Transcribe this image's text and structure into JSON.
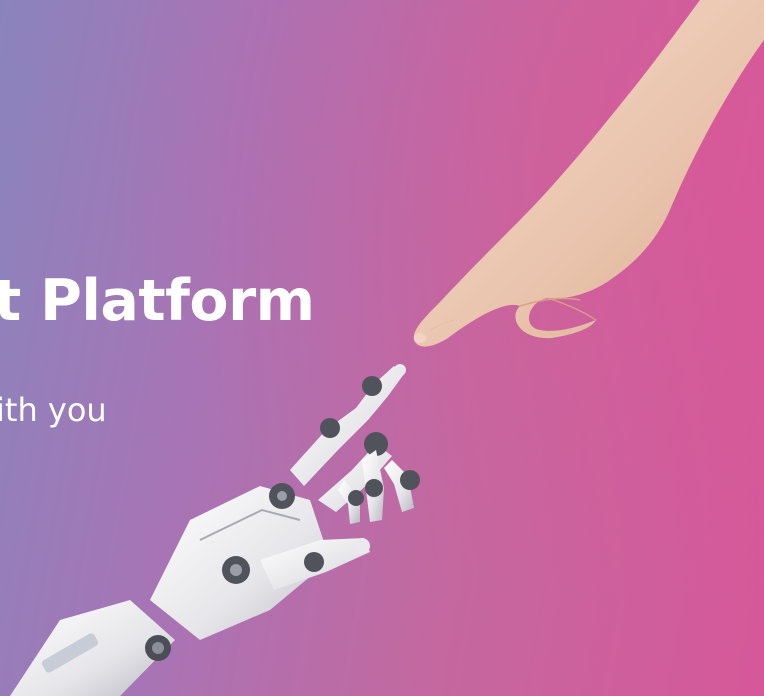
{
  "hero": {
    "headline": "t Platform",
    "subline": "ith you"
  },
  "colors": {
    "gradient_left": "#8a84bd",
    "gradient_mid": "#c4689f",
    "gradient_right": "#d6589a",
    "text": "#ffffff"
  },
  "imagery": {
    "human_hand": "human-hand-illustration",
    "robot_hand": "robot-hand-illustration"
  }
}
